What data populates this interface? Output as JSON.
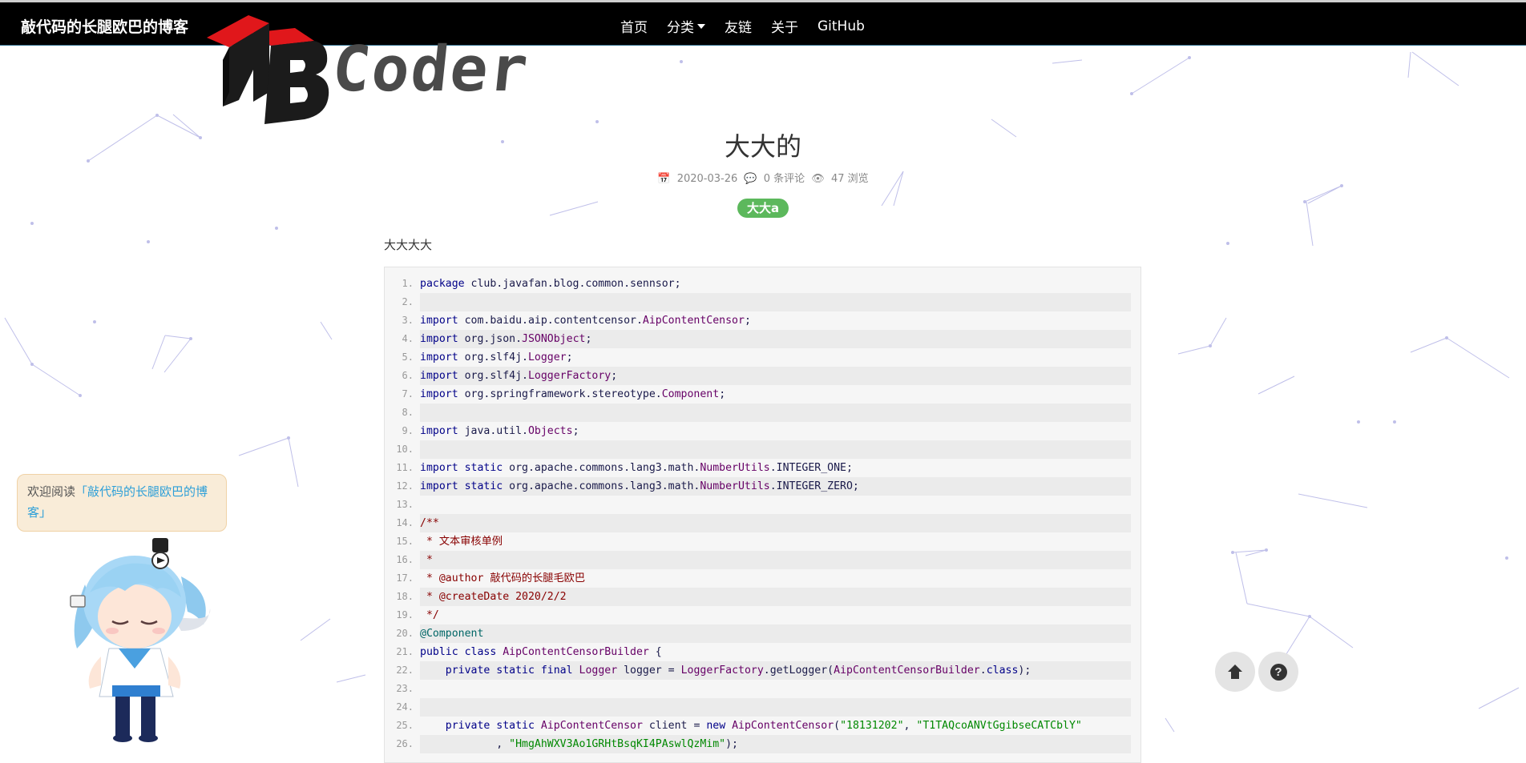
{
  "site": {
    "brand": "敲代码的长腿欧巴的博客",
    "nav": [
      {
        "label": "首页"
      },
      {
        "label": "分类",
        "has_dropdown": true
      },
      {
        "label": "友链"
      },
      {
        "label": "关于"
      },
      {
        "label": "GitHub"
      }
    ]
  },
  "logo": {
    "text": "Coder"
  },
  "article": {
    "title": "大大的",
    "date": "2020-03-26",
    "comments": "0 条评论",
    "views": "47 浏览",
    "tag": "大大a",
    "paragraph": "大大大大"
  },
  "code": {
    "lines": [
      [
        [
          "kw",
          "package"
        ],
        [
          "pl",
          " club.javafan.blog.common.sennsor;"
        ]
      ],
      [],
      [
        [
          "kw",
          "import"
        ],
        [
          "pl",
          " com.baidu.aip.contentcensor."
        ],
        [
          "ty",
          "AipContentCensor"
        ],
        [
          "pl",
          ";"
        ]
      ],
      [
        [
          "kw",
          "import"
        ],
        [
          "pl",
          " org.json."
        ],
        [
          "ty",
          "JSONObject"
        ],
        [
          "pl",
          ";"
        ]
      ],
      [
        [
          "kw",
          "import"
        ],
        [
          "pl",
          " org.slf4j."
        ],
        [
          "ty",
          "Logger"
        ],
        [
          "pl",
          ";"
        ]
      ],
      [
        [
          "kw",
          "import"
        ],
        [
          "pl",
          " org.slf4j."
        ],
        [
          "ty",
          "LoggerFactory"
        ],
        [
          "pl",
          ";"
        ]
      ],
      [
        [
          "kw",
          "import"
        ],
        [
          "pl",
          " org.springframework.stereotype."
        ],
        [
          "ty",
          "Component"
        ],
        [
          "pl",
          ";"
        ]
      ],
      [],
      [
        [
          "kw",
          "import"
        ],
        [
          "pl",
          " java.util."
        ],
        [
          "ty",
          "Objects"
        ],
        [
          "pl",
          ";"
        ]
      ],
      [],
      [
        [
          "kw",
          "import"
        ],
        [
          "kw",
          " static"
        ],
        [
          "pl",
          " org.apache.commons.lang3.math."
        ],
        [
          "ty",
          "NumberUtils"
        ],
        [
          "pl",
          ".INTEGER_ONE;"
        ]
      ],
      [
        [
          "kw",
          "import"
        ],
        [
          "kw",
          " static"
        ],
        [
          "pl",
          " org.apache.commons.lang3.math."
        ],
        [
          "ty",
          "NumberUtils"
        ],
        [
          "pl",
          ".INTEGER_ZERO;"
        ]
      ],
      [],
      [
        [
          "cm",
          "/**"
        ]
      ],
      [
        [
          "cm",
          " * 文本审核单例"
        ]
      ],
      [
        [
          "cm",
          " *"
        ]
      ],
      [
        [
          "cm",
          " * @author 敲代码的长腿毛欧巴"
        ]
      ],
      [
        [
          "cm",
          " * @createDate 2020/2/2"
        ]
      ],
      [
        [
          "cm",
          " */"
        ]
      ],
      [
        [
          "an",
          "@Component"
        ]
      ],
      [
        [
          "kw",
          "public"
        ],
        [
          "kw",
          " class"
        ],
        [
          "pl",
          " "
        ],
        [
          "ty",
          "AipContentCensorBuilder"
        ],
        [
          "pl",
          " {"
        ]
      ],
      [
        [
          "pl",
          "    "
        ],
        [
          "kw",
          "private"
        ],
        [
          "kw",
          " static"
        ],
        [
          "kw",
          " final"
        ],
        [
          "pl",
          " "
        ],
        [
          "ty",
          "Logger"
        ],
        [
          "pl",
          " logger = "
        ],
        [
          "ty",
          "LoggerFactory"
        ],
        [
          "pl",
          ".getLogger("
        ],
        [
          "ty",
          "AipContentCensorBuilder"
        ],
        [
          "pl",
          "."
        ],
        [
          "kw",
          "class"
        ],
        [
          "pl",
          ");"
        ]
      ],
      [],
      [],
      [
        [
          "pl",
          "    "
        ],
        [
          "kw",
          "private"
        ],
        [
          "kw",
          " static"
        ],
        [
          "pl",
          " "
        ],
        [
          "ty",
          "AipContentCensor"
        ],
        [
          "pl",
          " client = "
        ],
        [
          "kw",
          "new"
        ],
        [
          "pl",
          " "
        ],
        [
          "ty",
          "AipContentCensor"
        ],
        [
          "pl",
          "("
        ],
        [
          "st",
          "\"18131202\""
        ],
        [
          "pl",
          ", "
        ],
        [
          "st",
          "\"T1TAQcoANVtGgibseCATCblY\""
        ]
      ],
      [
        [
          "pl",
          "            , "
        ],
        [
          "st",
          "\"HmgAhWXV3Ao1GRHtBsqKI4PAswlQzMim\""
        ],
        [
          "pl",
          ");"
        ]
      ]
    ]
  },
  "mascot": {
    "greeting_prefix": "欢迎阅读",
    "greeting_link": "「敲代码的长腿欧巴的博客」"
  },
  "colors": {
    "nav_bg": "#000000",
    "tag_bg": "#5cb85c",
    "keyword": "#000088",
    "type": "#660066",
    "comment": "#880000",
    "annotation": "#006666",
    "string": "#008800"
  }
}
